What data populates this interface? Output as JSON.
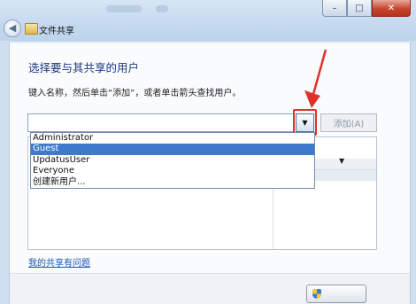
{
  "window": {
    "title": "文件共享",
    "controls": {
      "minimize": "–",
      "maximize": "□",
      "close": "✕"
    },
    "back_icon": "back-arrow-icon"
  },
  "dialog": {
    "heading": "选择要与其共享的用户",
    "instruction": "键入名称，然后单击“添加”，或者单击箭头查找用户。",
    "name_input": {
      "value": "",
      "placeholder": ""
    },
    "add_button": "添加(A)",
    "dropdown_options": [
      "Administrator",
      "Guest",
      "UpdatusUser",
      "Everyone",
      "创建新用户..."
    ],
    "selected_option": "Guest",
    "help_link": "我的共享有问题"
  },
  "colors": {
    "heading": "#1d3b7f",
    "selection": "#3f79cc",
    "annotation": "#e0302a",
    "link": "#1b57b5"
  }
}
